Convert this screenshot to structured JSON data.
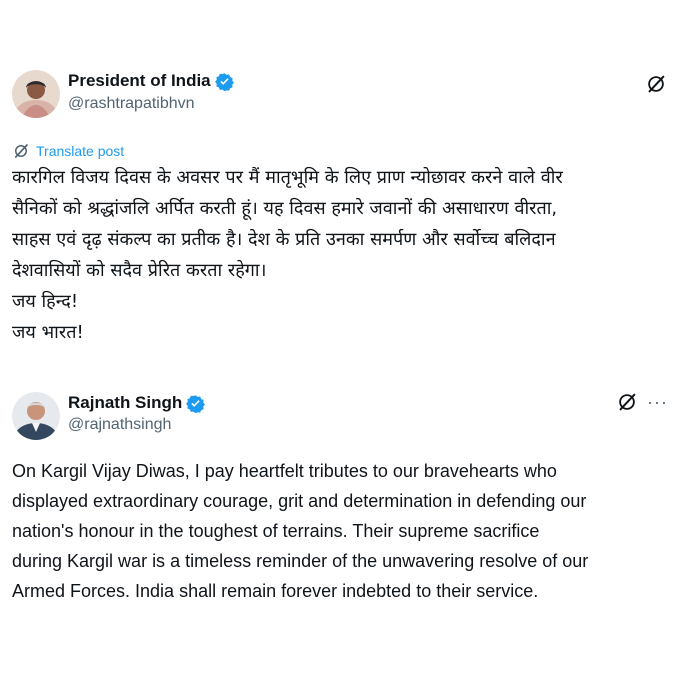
{
  "posts": [
    {
      "author": {
        "name": "President of India",
        "handle": "@rashtrapatibhvn",
        "verified": true,
        "avatar_icon": "person-avatar"
      },
      "translate_label": "Translate post",
      "text_lines": [
        "कारगिल विजय दिवस के अवसर पर मैं मातृभूमि के लिए प्राण न्योछावर करने वाले वीर",
        "सैनिकों को श्रद्धांजलि अर्पित करती हूं। यह दिवस हमारे जवानों की असाधारण वीरता,",
        "साहस एवं दृढ़ संकल्प का प्रतीक है। देश के प्रति उनका समर्पण और सर्वोच्च बलिदान",
        "देशवासियों को सदैव प्रेरित करता रहेगा।",
        "जय हिन्द!",
        "जय भारत!"
      ],
      "actions": [
        "grok-icon"
      ]
    },
    {
      "author": {
        "name": "Rajnath Singh",
        "handle": "@rajnathsingh",
        "verified": true,
        "avatar_icon": "person-avatar"
      },
      "text_lines": [
        "On Kargil Vijay Diwas, I pay heartfelt tributes to our bravehearts who",
        "displayed extraordinary courage, grit and determination in defending our",
        "nation's honour in the toughest of terrains. Their supreme sacrifice",
        "during Kargil war is a timeless reminder of the unwavering resolve of our",
        "Armed Forces. India shall remain forever indebted to their service."
      ],
      "actions": [
        "grok-icon",
        "more-icon"
      ],
      "more_label": "···"
    }
  ],
  "colors": {
    "verified": "#1d9bf0",
    "link": "#1d9bf0",
    "secondary_text": "#536471",
    "primary_text": "#0f1419"
  }
}
